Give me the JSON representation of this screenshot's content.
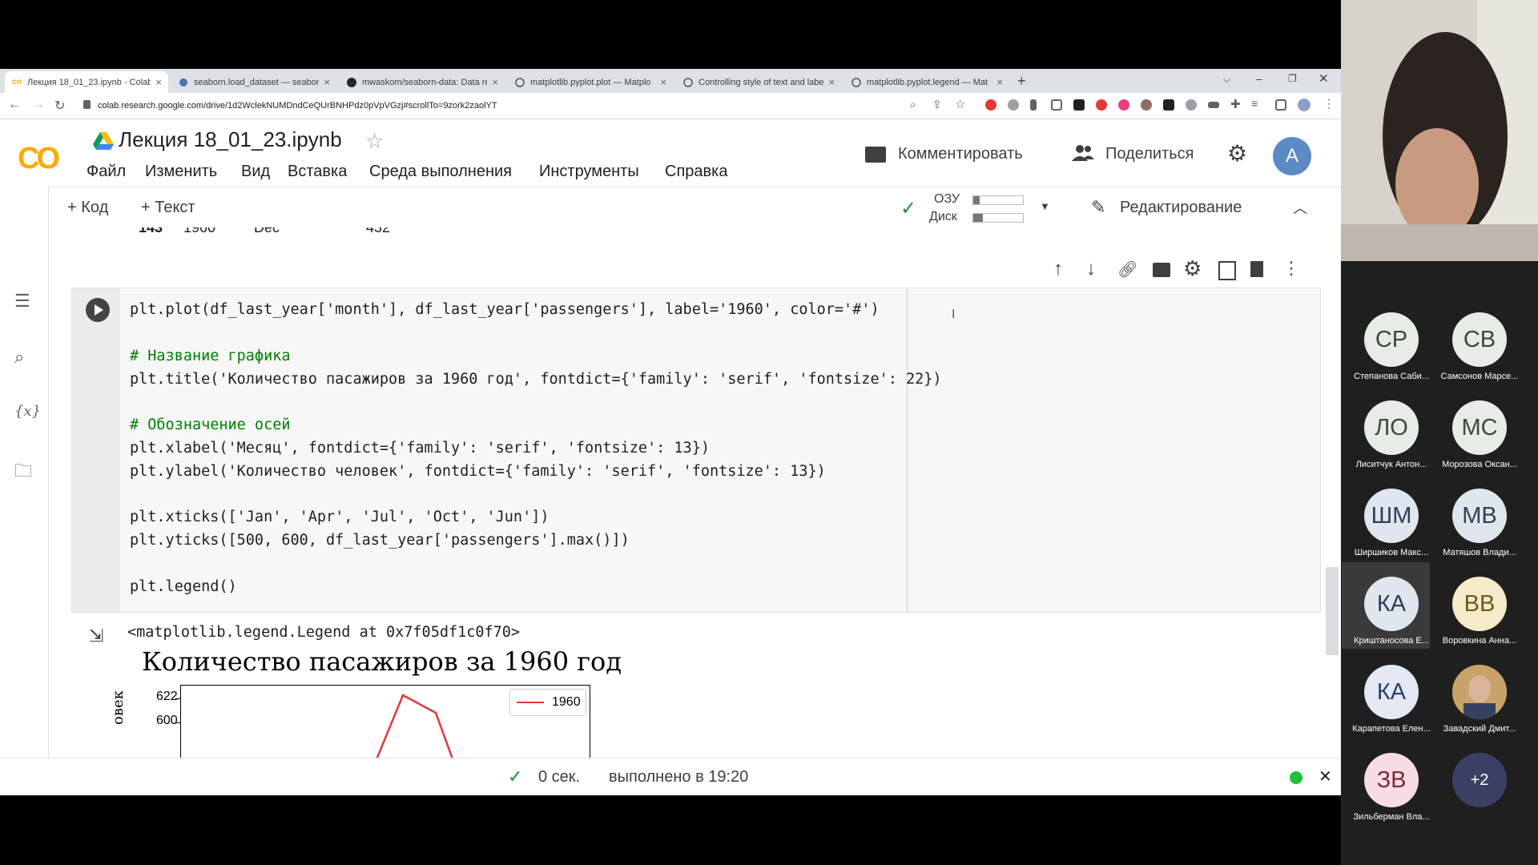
{
  "browser": {
    "tabs": [
      {
        "label": "Лекция 18_01_23.ipynb - Colab",
        "icon": "colab"
      },
      {
        "label": "seaborn.load_dataset — seaborn",
        "icon": "seaborn"
      },
      {
        "label": "mwaskom/seaborn-data: Data re",
        "icon": "github"
      },
      {
        "label": "matplotlib.pyplot.plot — Matplo",
        "icon": "matplotlib"
      },
      {
        "label": "Controlling style of text and labe",
        "icon": "matplotlib"
      },
      {
        "label": "matplotlib.pyplot.legend — Mat",
        "icon": "matplotlib"
      }
    ],
    "url": "colab.research.google.com/drive/1d2WclekNUMDndCeQUrBNHPdz0pVpVGzj#scrollTo=9zork2zaolYT"
  },
  "colab": {
    "logo": "CO",
    "notebook_title": "Лекция 18_01_23.ipynb",
    "menu": [
      "Файл",
      "Изменить",
      "Вид",
      "Вставка",
      "Среда выполнения",
      "Инструменты",
      "Справка"
    ],
    "comment_label": "Комментировать",
    "share_label": "Поделиться",
    "avatar_letter": "A",
    "add_code_label": "+ Код",
    "add_text_label": "+ Текст",
    "ram_label": "ОЗУ",
    "disk_label": "Диск",
    "editing_label": "Редактирование",
    "prev_row": {
      "index": "143",
      "year": "1960",
      "month": "Dec",
      "value": "432"
    }
  },
  "cell": {
    "lines": [
      "plt.plot(df_last_year['month'], df_last_year['passengers'], label='1960', color='#')",
      "",
      "# Название графика",
      "plt.title('Количество пасажиров за 1960 год', fontdict={'family': 'serif', 'fontsize': 22})",
      "",
      "# Обозначение осей",
      "plt.xlabel('Месяц', fontdict={'family': 'serif', 'fontsize': 13})",
      "plt.ylabel('Количество человек', fontdict={'family': 'serif', 'fontsize': 13})",
      "",
      "plt.xticks(['Jan', 'Apr', 'Jul', 'Oct', 'Jun'])",
      "plt.yticks([500, 600, df_last_year['passengers'].max()])",
      "",
      "plt.legend()"
    ],
    "output_text": "<matplotlib.legend.Legend at 0x7f05df1c0f70>",
    "plot": {
      "title": "Количество пасажиров за 1960 год",
      "ylabel_visible": "овек",
      "yticks": [
        "622",
        "600"
      ],
      "legend_label": "1960",
      "line_color": "#e8353a"
    }
  },
  "status": {
    "duration": "0 сек.",
    "completed": "выполнено в 19:20"
  },
  "participants": [
    {
      "initials": "СР",
      "name": "Степанова Саби...",
      "bg": "#e7ece7",
      "fg": "#3b4a3b"
    },
    {
      "initials": "СВ",
      "name": "Самсонов Марсе...",
      "bg": "#e7ece7",
      "fg": "#3b4a3b"
    },
    {
      "initials": "ЛО",
      "name": "Лиситчук Антон...",
      "bg": "#e7ece7",
      "fg": "#3b4a3b"
    },
    {
      "initials": "МС",
      "name": "Морозова Оксан...",
      "bg": "#e7ece7",
      "fg": "#3b4a3b"
    },
    {
      "initials": "ШМ",
      "name": "Ширшиков Макс...",
      "bg": "#dfe6ee",
      "fg": "#2f3f55"
    },
    {
      "initials": "МВ",
      "name": "Матяшов Влади...",
      "bg": "#dfe6ee",
      "fg": "#2f3f55"
    },
    {
      "initials": "КА",
      "name": "Криштаносова Е...",
      "bg": "#dfe6ee",
      "fg": "#2f3f55"
    },
    {
      "initials": "ВВ",
      "name": "Воровкина Анна...",
      "bg": "#f5ebc9",
      "fg": "#6b5a1a"
    },
    {
      "initials": "КА",
      "name": "Карапетова Елен...",
      "bg": "#e3e8f3",
      "fg": "#2c3e6b"
    },
    {
      "initials": "",
      "name": "Завадский Дмит...",
      "bg": "#b48a5a",
      "fg": "#fff"
    },
    {
      "initials": "ЗВ",
      "name": "Зильберман Вла...",
      "bg": "#f7dde3",
      "fg": "#7a2a3a"
    },
    {
      "initials": "+2",
      "name": "",
      "bg": "#3b3f63",
      "fg": "#fff"
    }
  ]
}
